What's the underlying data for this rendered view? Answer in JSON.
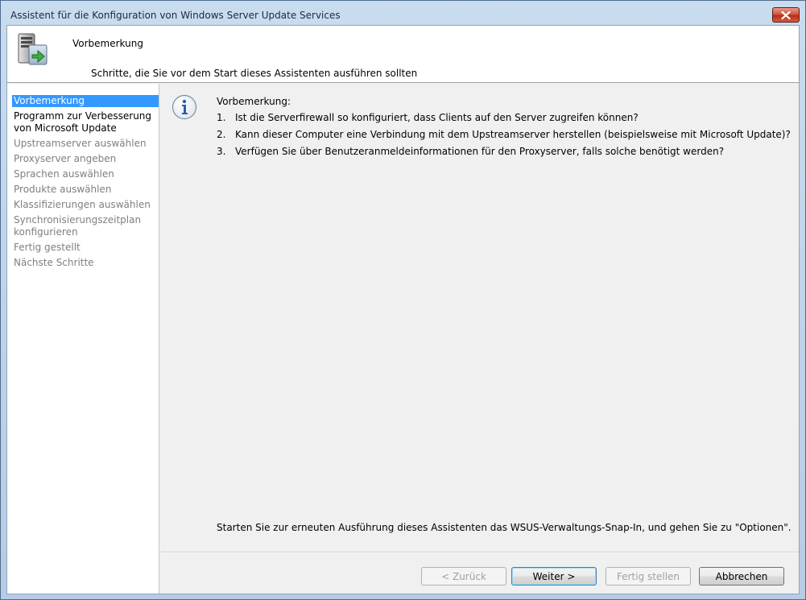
{
  "window": {
    "title": "Assistent für die Konfiguration von Windows Server Update Services",
    "close_icon": "close-icon"
  },
  "header": {
    "icon": "server-update-icon",
    "title": "Vorbemerkung",
    "subtitle": "Schritte, die Sie vor dem Start dieses Assistenten ausführen sollten"
  },
  "sidebar": {
    "items": [
      {
        "label": "Vorbemerkung",
        "state": "active"
      },
      {
        "label": "Programm zur Verbesserung von Microsoft Update",
        "state": "done"
      },
      {
        "label": "Upstreamserver auswählen",
        "state": "pending"
      },
      {
        "label": "Proxyserver angeben",
        "state": "pending"
      },
      {
        "label": "Sprachen auswählen",
        "state": "pending"
      },
      {
        "label": "Produkte auswählen",
        "state": "pending"
      },
      {
        "label": "Klassifizierungen auswählen",
        "state": "pending"
      },
      {
        "label": "Synchronisierungszeitplan konfigurieren",
        "state": "pending"
      },
      {
        "label": "Fertig gestellt",
        "state": "pending"
      },
      {
        "label": "Nächste Schritte",
        "state": "pending"
      }
    ]
  },
  "main": {
    "info_icon": "info-icon",
    "intro": "Vorbemerkung:",
    "steps": [
      {
        "num": "1.",
        "text": "Ist die Serverfirewall so konfiguriert, dass Clients auf den Server zugreifen können?"
      },
      {
        "num": "2.",
        "text": "Kann dieser Computer eine Verbindung mit dem Upstreamserver herstellen (beispielsweise mit Microsoft Update)?"
      },
      {
        "num": "3.",
        "text": "Verfügen Sie über Benutzeranmeldeinformationen für den Proxyserver, falls solche benötigt werden?"
      }
    ],
    "footer_note": "Starten Sie zur erneuten Ausführung dieses Assistenten das WSUS-Verwaltungs-Snap-In, und gehen Sie zu \"Optionen\"."
  },
  "buttons": {
    "back": "< Zurück",
    "next": "Weiter >",
    "finish": "Fertig stellen",
    "cancel": "Abbrechen"
  }
}
